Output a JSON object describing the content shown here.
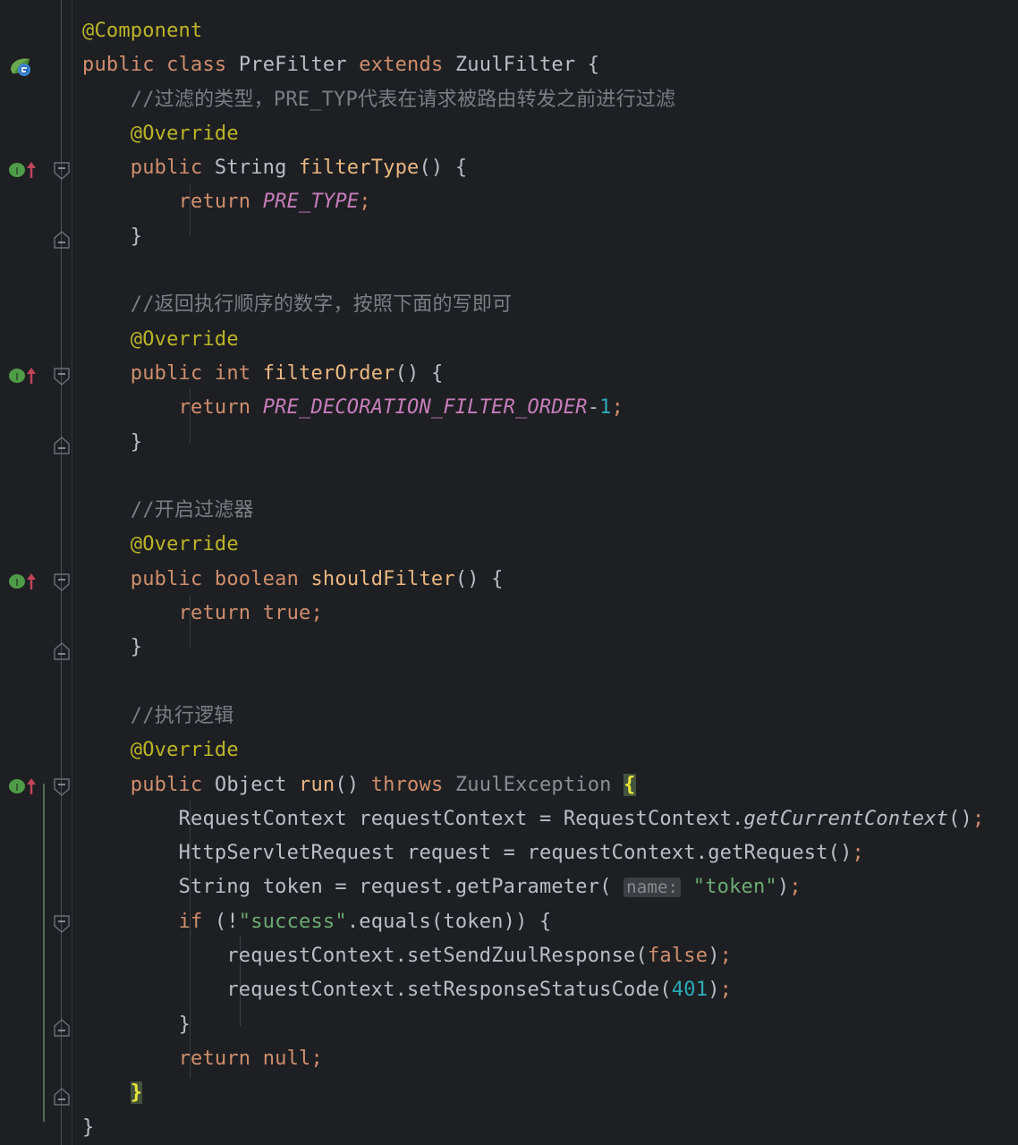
{
  "editor": {
    "theme": "darcula",
    "background": "#1e1f22",
    "font_size_px": 22,
    "language": "Java"
  },
  "colors": {
    "background": "#1e1f22",
    "default_text": "#bcbec4",
    "keyword": "#cf8e6d",
    "annotation": "#bbb529",
    "comment": "#7a7e85",
    "string": "#6aab73",
    "number": "#2aacb8",
    "constant": "#c77dbb",
    "method_declaration": "#e9b782",
    "inlay_hint_bg": "#3c3f41",
    "brace_match_bg": "#43523d",
    "brace_match_fg": "#e8e83a",
    "gutter_rail": "#4b4e53",
    "block_rail": "#5a7a66"
  },
  "gutter": {
    "icons": [
      {
        "name": "spring-bean-icon",
        "label": "Spring Bean",
        "line": 2,
        "type": "spring"
      },
      {
        "name": "implementing-method-icon",
        "label": "Implements method",
        "line": 5,
        "type": "implement"
      },
      {
        "name": "implementing-method-icon",
        "label": "Implements method",
        "line": 11,
        "type": "implement"
      },
      {
        "name": "implementing-method-icon",
        "label": "Implements method",
        "line": 17,
        "type": "implement"
      },
      {
        "name": "implementing-method-icon",
        "label": "Implements method",
        "line": 23,
        "type": "implement"
      }
    ],
    "fold_markers": [
      {
        "line": 5,
        "state": "expanded-start"
      },
      {
        "line": 7,
        "state": "expanded-end"
      },
      {
        "line": 11,
        "state": "expanded-start"
      },
      {
        "line": 13,
        "state": "expanded-end"
      },
      {
        "line": 17,
        "state": "expanded-start"
      },
      {
        "line": 19,
        "state": "expanded-end"
      },
      {
        "line": 23,
        "state": "expanded-start"
      },
      {
        "line": 27,
        "state": "expanded-start"
      },
      {
        "line": 30,
        "state": "expanded-end"
      },
      {
        "line": 32,
        "state": "expanded-end"
      }
    ]
  },
  "code": {
    "file_snippet": "PreFilter.java",
    "lines": [
      {
        "n": 1,
        "indent": 0,
        "text": "@Component"
      },
      {
        "n": 2,
        "indent": 0,
        "text": "public class PreFilter extends ZuulFilter {"
      },
      {
        "n": 3,
        "indent": 1,
        "text": "//过滤的类型，PRE_TYP代表在请求被路由转发之前进行过滤"
      },
      {
        "n": 4,
        "indent": 1,
        "text": "@Override"
      },
      {
        "n": 5,
        "indent": 1,
        "text": "public String filterType() {"
      },
      {
        "n": 6,
        "indent": 2,
        "text": "return PRE_TYPE;"
      },
      {
        "n": 7,
        "indent": 1,
        "text": "}"
      },
      {
        "n": 8,
        "indent": 0,
        "text": ""
      },
      {
        "n": 9,
        "indent": 1,
        "text": "//返回执行顺序的数字，按照下面的写即可"
      },
      {
        "n": 10,
        "indent": 1,
        "text": "@Override"
      },
      {
        "n": 11,
        "indent": 1,
        "text": "public int filterOrder() {"
      },
      {
        "n": 12,
        "indent": 2,
        "text": "return PRE_DECORATION_FILTER_ORDER-1;"
      },
      {
        "n": 13,
        "indent": 1,
        "text": "}"
      },
      {
        "n": 14,
        "indent": 0,
        "text": ""
      },
      {
        "n": 15,
        "indent": 1,
        "text": "//开启过滤器"
      },
      {
        "n": 16,
        "indent": 1,
        "text": "@Override"
      },
      {
        "n": 17,
        "indent": 1,
        "text": "public boolean shouldFilter() {"
      },
      {
        "n": 18,
        "indent": 2,
        "text": "return true;"
      },
      {
        "n": 19,
        "indent": 1,
        "text": "}"
      },
      {
        "n": 20,
        "indent": 0,
        "text": ""
      },
      {
        "n": 21,
        "indent": 1,
        "text": "//执行逻辑"
      },
      {
        "n": 22,
        "indent": 1,
        "text": "@Override"
      },
      {
        "n": 23,
        "indent": 1,
        "text": "public Object run() throws ZuulException {"
      },
      {
        "n": 24,
        "indent": 2,
        "text": "RequestContext requestContext = RequestContext.getCurrentContext();"
      },
      {
        "n": 25,
        "indent": 2,
        "text": "HttpServletRequest request = requestContext.getRequest();"
      },
      {
        "n": 26,
        "indent": 2,
        "text": "String token = request.getParameter( name: \"token\");"
      },
      {
        "n": 27,
        "indent": 2,
        "text": "if (!\"success\".equals(token)) {"
      },
      {
        "n": 28,
        "indent": 3,
        "text": "requestContext.setSendZuulResponse(false);"
      },
      {
        "n": 29,
        "indent": 3,
        "text": "requestContext.setResponseStatusCode(401);"
      },
      {
        "n": 30,
        "indent": 2,
        "text": "}"
      },
      {
        "n": 31,
        "indent": 2,
        "text": "return null;"
      },
      {
        "n": 32,
        "indent": 1,
        "text": "}"
      },
      {
        "n": 33,
        "indent": 0,
        "text": "}"
      }
    ],
    "inlay_hints": [
      {
        "line": 26,
        "label": "name:",
        "for_argument": "\"token\""
      }
    ],
    "matched_braces": [
      {
        "line": 23,
        "char": "{"
      },
      {
        "line": 32,
        "char": "}"
      }
    ]
  }
}
